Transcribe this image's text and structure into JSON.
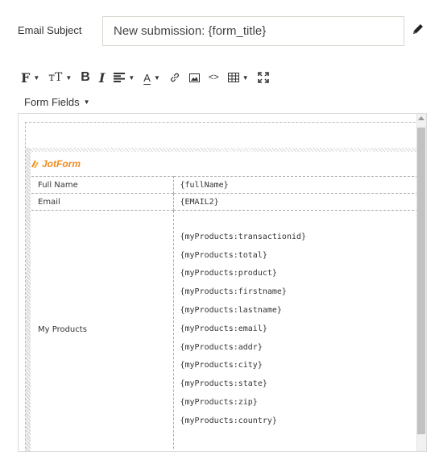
{
  "subject": {
    "label": "Email Subject",
    "value": "New submission: {form_title}"
  },
  "toolbar": {
    "font_label": "F",
    "size_label": "тT",
    "bold_label": "B",
    "italic_label": "I",
    "color_label": "A",
    "code_label": "<>",
    "icons": [
      "font-family-icon",
      "font-size-icon",
      "bold-icon",
      "italic-icon",
      "align-icon",
      "text-color-icon",
      "link-icon",
      "image-icon",
      "code-icon",
      "table-icon",
      "fullscreen-icon"
    ]
  },
  "form_fields": {
    "label": "Form Fields"
  },
  "email": {
    "brand": "JotForm",
    "brand_color": "#f28b1e",
    "rows": [
      {
        "label": "Full Name",
        "value": "{fullName}"
      },
      {
        "label": "Email",
        "value": "{EMAIL2}"
      }
    ],
    "products": {
      "label": "My Products",
      "values": [
        "{myProducts:transactionid}",
        "{myProducts:total}",
        "{myProducts:product}",
        "{myProducts:firstname}",
        "{myProducts:lastname}",
        "{myProducts:email}",
        "{myProducts:addr}",
        "{myProducts:city}",
        "{myProducts:state}",
        "{myProducts:zip}",
        "{myProducts:country}"
      ]
    }
  }
}
